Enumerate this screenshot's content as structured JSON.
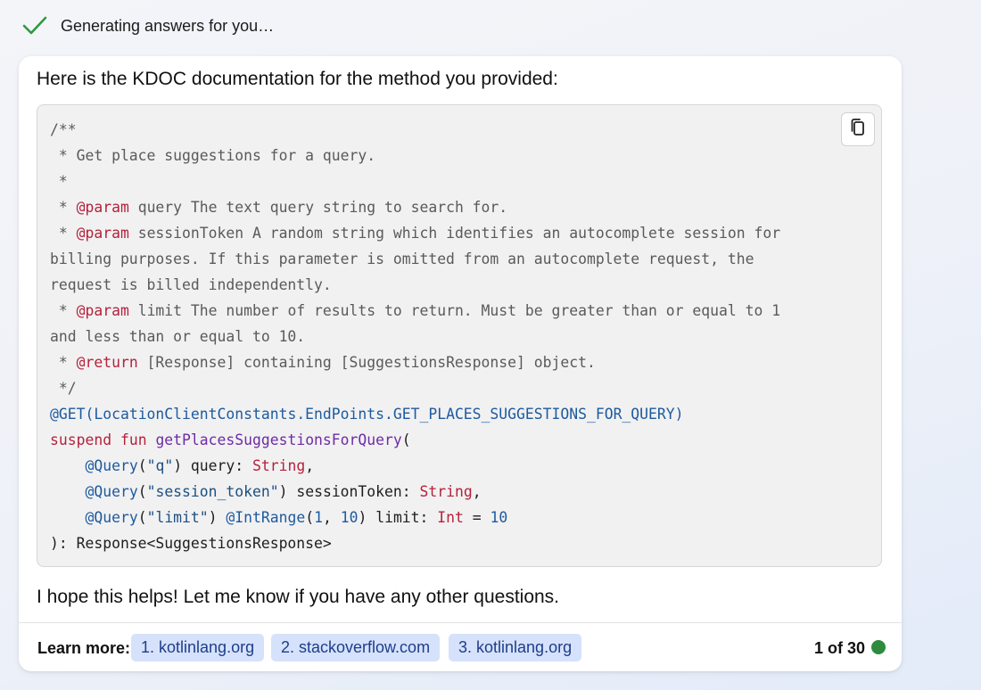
{
  "status": {
    "text": "Generating answers for you…",
    "icon": "checkmark-icon",
    "color": "#2e9a3f"
  },
  "answer": {
    "intro": "Here is the KDOC documentation for the method you provided:",
    "code_language": "kotlin",
    "copy_icon": "copy-icon",
    "code_lines": [
      "/**",
      " * Get place suggestions for a query.",
      " *",
      " * @param query The text query string to search for.",
      " * @param sessionToken A random string which identifies an autocomplete session for",
      "billing purposes. If this parameter is omitted from an autocomplete request, the",
      "request is billed independently.",
      " * @param limit The number of results to return. Must be greater than or equal to 1",
      "and less than or equal to 10.",
      " * @return [Response] containing [SuggestionsResponse] object.",
      " */",
      "@GET(LocationClientConstants.EndPoints.GET_PLACES_SUGGESTIONS_FOR_QUERY)",
      "suspend fun getPlacesSuggestionsForQuery(",
      "    @Query(\"q\") query: String,",
      "    @Query(\"session_token\") sessionToken: String,",
      "    @Query(\"limit\") @IntRange(1, 10) limit: Int = 10",
      "): Response<SuggestionsResponse>"
    ],
    "outro": "I hope this helps! Let me know if you have any other questions."
  },
  "footer": {
    "learn_more_label": "Learn more:",
    "links": [
      "1. kotlinlang.org",
      "2. stackoverflow.com",
      "3. kotlinlang.org"
    ],
    "count": "1 of 30",
    "status_dot_color": "#2e8b3e"
  },
  "colors": {
    "chip_bg": "#d6e2fb",
    "chip_text": "#1d3e8a",
    "keyword": "#b5223a",
    "annotation": "#1d5a9e",
    "function": "#6f2ba5"
  }
}
